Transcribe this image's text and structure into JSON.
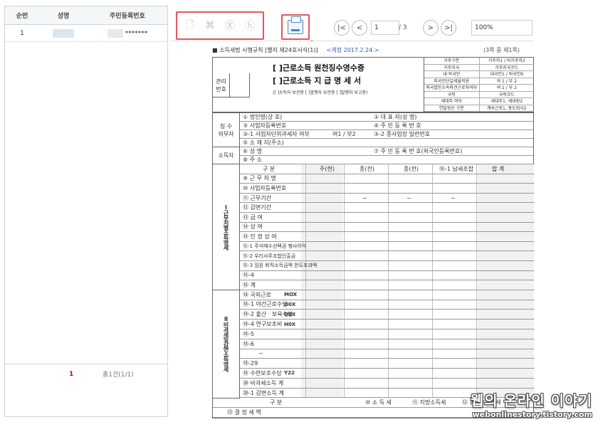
{
  "list": {
    "headers": [
      "순번",
      "성명",
      "주민등록번호"
    ],
    "rows": [
      {
        "no": "1",
        "rrn_masked": "*******"
      }
    ],
    "pagination": {
      "current": "1",
      "total": "총1건(1/1)"
    }
  },
  "toolbar": {
    "page_input": "1",
    "page_total": "/ 3",
    "zoom": "100%",
    "nav": {
      "first": "|<",
      "prev": "<",
      "next": ">",
      "last": ">|"
    }
  },
  "document": {
    "law_ref": "■ 소득세법 시행규칙 [별지 제24호서식(1)]",
    "revision": "<개정 2017.2.24.>",
    "page_of": "(3쪽 중 제1쪽)",
    "mgmt_label": [
      "관리",
      "번호"
    ],
    "title1": "[  ]근로소득 원천징수영수증",
    "title2": "[  ]근로소득 지 급 명 세 서",
    "title_sub": "([  ]소득자 보관용 [  ]발행자 보관용 [  ]발행자 보고용)",
    "resident_rows": [
      [
        "거주구분",
        "거주자1 / 비거주자2"
      ],
      [
        "거주지국",
        "거주지국코드"
      ],
      [
        "내·외국인",
        "내국인1 / 외국인9"
      ],
      [
        "외국인단일세율적용",
        "여 1 / 부 2"
      ],
      [
        "외국법인소속파견근로자여부",
        "여 1 / 부 2"
      ],
      [
        "국적",
        "국적코드"
      ],
      [
        "세대주 여부",
        "세대주1, 세대원2"
      ],
      [
        "연말정산 구분",
        "계속근로1, 중도퇴사2"
      ]
    ],
    "payer_label": "징 수\n의무자",
    "payer_rows": [
      {
        "left": "① 법인명(상  호)",
        "right": "② 대 표 자(성   명)"
      },
      {
        "left": "③ 사업자등록번호",
        "right": "④ 주 민 등 록 번 호"
      },
      {
        "left": "③-1 사업자단위과세자 여부",
        "mid": "여1 / 부2",
        "right": "③-2 종사업장 일련번호"
      },
      {
        "left": "⑤ 소 재 지(주소)",
        "right": ""
      }
    ],
    "earner_label": "소득자",
    "earner_rows": [
      {
        "left": "⑥ 성          명",
        "right": "⑦ 주 민 등 록 번 호(외국인등록번호)"
      },
      {
        "left": "⑧ 주          소",
        "right": ""
      }
    ],
    "sec1_label": "Ⅰ근무처별소득명세",
    "sec1_header": [
      "구    분",
      "주(현)",
      "종(전)",
      "종(전)",
      "⑯-1 납세조합",
      "합    계"
    ],
    "sec1_rows": [
      "⑨ 근 무 처 명",
      "⑩ 사업자등록번호",
      "⑪ 근무기간",
      "⑫ 감면기간",
      "⑬ 급           여",
      "⑭ 상           여",
      "⑮ 인 정 상 여",
      "⑮-1 주식매수선택권 행사이익",
      "⑮-2 우리사주조합인출금",
      "⑮-3 임원 퇴직소득금액 한도초과액",
      "⑮-4",
      "⑯ 계"
    ],
    "period_dash": "~",
    "sec2_label": "Ⅱ비과세및감면소득명세",
    "sec2_rows": [
      {
        "label": "⑱ 국외근로",
        "code": "MOX"
      },
      {
        "label": "⑱-1 야간근로수당",
        "code": "O0X"
      },
      {
        "label": "⑱-2 출산 · 보육수당",
        "code": "Q0X"
      },
      {
        "label": "⑱-4 연구보조비",
        "code": "H0X"
      },
      {
        "label": "⑱-5",
        "code": ""
      },
      {
        "label": "⑱-6",
        "code": ""
      },
      {
        "label": "~",
        "code": ""
      },
      {
        "label": "⑱-29",
        "code": ""
      },
      {
        "label": "⑲ 수련보조수당",
        "code": "Y22"
      },
      {
        "label": "⑳ 비과세소득 계",
        "code": ""
      },
      {
        "label": "⑳-1 감면소득 계",
        "code": ""
      }
    ],
    "sec3_header": [
      "구    분",
      "⑩ 소 득 세",
      "⑪ 지방소득세",
      "⑫ 농어촌특별세"
    ],
    "sec3_row": "⑬ 결    정    세    액"
  },
  "watermark": {
    "line1": "웹의 온라인 이야기",
    "line2": "webonlinestory.tistory.com"
  }
}
